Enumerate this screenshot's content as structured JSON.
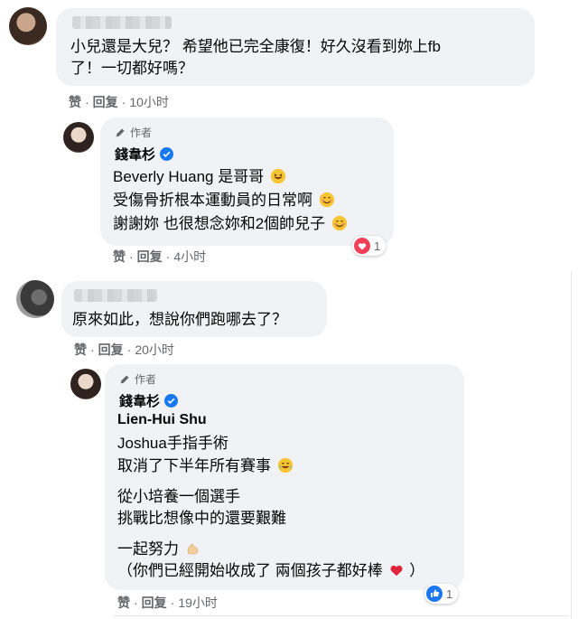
{
  "comments": [
    {
      "lines": [
        "小兒還是大兒？ 希望他已完全康復！好久沒看到妳上fb",
        "了！一切都好嗎？"
      ],
      "actions": {
        "like": "赞",
        "reply": "回复",
        "time": "10小时"
      }
    },
    {
      "author_tag": "作者",
      "name": "錢韋杉",
      "lines": [
        "Beverly Huang 是哥哥",
        "受傷骨折根本運動員的日常啊",
        "謝謝妳 也很想念妳和2個帥兒子"
      ],
      "reaction": {
        "type": "love",
        "count": "1",
        "color": "#f33e58"
      },
      "actions": {
        "like": "赞",
        "reply": "回复",
        "time": "4小时"
      }
    },
    {
      "lines": [
        "原來如此，想說你們跑哪去了？"
      ],
      "actions": {
        "like": "赞",
        "reply": "回复",
        "time": "20小时"
      }
    },
    {
      "author_tag": "作者",
      "name": "錢韋杉",
      "mention": "Lien-Hui Shu",
      "lines": [
        "Joshua手指手術",
        "取消了下半年所有賽事",
        "從小培養一個選手",
        "挑戰比想像中的還要艱難",
        "一起努力",
        "（你們已經開始收成了 兩個孩子都好棒",
        "）"
      ],
      "reaction": {
        "type": "like",
        "count": "1",
        "color": "#1877f2"
      },
      "actions": {
        "like": "赞",
        "reply": "回复",
        "time": "19小时"
      }
    }
  ],
  "colors": {
    "bubble": "#f0f2f5",
    "meta": "#65676b",
    "verified": "#1877f2",
    "text": "#050505"
  },
  "icons": {
    "verified": "verified-badge-icon",
    "author": "pencil-icon",
    "laugh": "grinning-sweat-emoji",
    "smile": "smiling-emoji",
    "tears": "tears-of-joy-emoji",
    "muscle": "flexed-biceps-emoji",
    "heart": "red-heart-emoji"
  }
}
